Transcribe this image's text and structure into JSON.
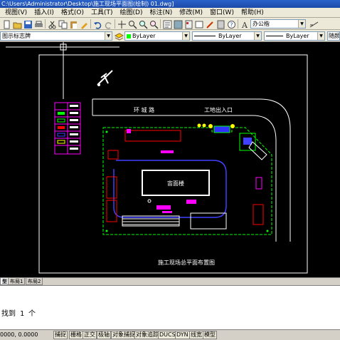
{
  "window": {
    "title": "C:\\Users\\Administrator\\Desktop\\施工现场平面图(绘制) 01.dwg]"
  },
  "menu": [
    "视图(V)",
    "插入(I)",
    "格式(O)",
    "工具(T)",
    "绘图(D)",
    "标注(N)",
    "修改(M)",
    "窗口(W)",
    "帮助(H)"
  ],
  "toolbar": {
    "font_style": "办公楷"
  },
  "properties": {
    "layer": "图示标志牌",
    "color": "ByLayer",
    "linetype": "ByLayer",
    "lineweight": "ByLayer",
    "plotstyle": "随颜色"
  },
  "drawing": {
    "road_label": "环  城  路",
    "gate_label": "工地出入口",
    "building_label": "宙面楼",
    "plan_title": "施工现场总平面布置图",
    "bg_color": "#000000",
    "line_white": "#ffffff",
    "line_green": "#00ff00",
    "line_magenta": "#ff00ff",
    "line_blue": "#4040ff",
    "line_red": "#ff0000"
  },
  "layout_tabs": [
    "型",
    "布局1",
    "布局2"
  ],
  "command": {
    "output": "找到 1 个"
  },
  "status": {
    "coords": "0000, 0.0000",
    "buttons": [
      "捕捉",
      "栅格",
      "正交",
      "极轴",
      "对象捕捉",
      "对象追踪",
      "DUCS",
      "DYN",
      "线宽",
      "模型"
    ]
  }
}
